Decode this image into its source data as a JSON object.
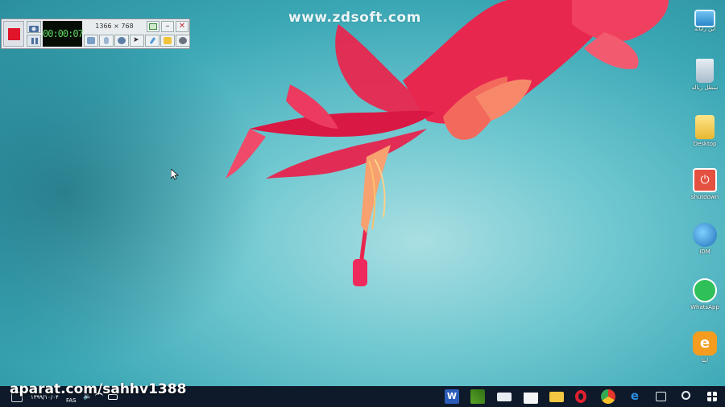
{
  "watermark": "www.zdsoft.com",
  "recorder": {
    "timer": "00:00:07",
    "resolution": "1366 × 768",
    "buttons": [
      "record",
      "snapshot",
      "pause",
      "restore",
      "minimize",
      "close",
      "audio",
      "microphone",
      "webcam",
      "cursor",
      "pen",
      "folder",
      "settings"
    ]
  },
  "desktop_icons": [
    {
      "label": "این رایانه",
      "icon": "computer-icon"
    },
    {
      "label": "سطل زباله",
      "icon": "recycle-bin-icon"
    },
    {
      "label": "Desktop",
      "icon": "folder-icon"
    },
    {
      "label": "shutdown",
      "icon": "power-icon"
    },
    {
      "label": "IDM",
      "icon": "idm-icon"
    },
    {
      "label": "WhatsApp",
      "icon": "whatsapp-icon"
    },
    {
      "label": "ایتا",
      "icon": "eitaa-icon"
    }
  ],
  "taskbar": {
    "overlay_text": "aparat.com/sahhv1388",
    "date": "۱۳۹۹/۱۰/۰۴",
    "language": "FAS",
    "pinned": [
      "word-icon",
      "minecraft-icon",
      "mail-icon",
      "store-icon",
      "file-explorer-icon",
      "opera-icon",
      "chrome-icon",
      "edge-icon",
      "task-view-icon",
      "search-icon",
      "start-icon"
    ]
  },
  "colors": {
    "background": "#5ec0cb",
    "taskbar": "#0e1a2a",
    "record_red": "#e0142b",
    "flower": "#e8274f"
  }
}
